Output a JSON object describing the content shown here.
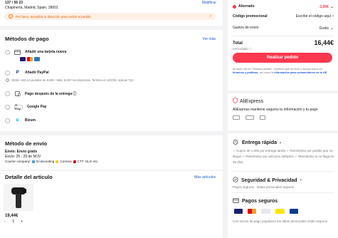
{
  "address": {
    "line1": "137 / 56 23",
    "line2": "Chapinería, Madrid, Spain, 28001",
    "modify_label": "Modificar",
    "warning": "Por favor, actualiza tu dirección para recibir el pedido",
    "warning_icon": "info-icon"
  },
  "payment": {
    "title": "Métodos de pago",
    "see_more": "Ver más",
    "methods": [
      {
        "label": "Añadir una tarjeta nueva",
        "icon": "card-icon"
      },
      {
        "label": "Añadir PayPal",
        "icon": "paypal-icon"
      },
      {
        "label": "Pago después de la entrega ⓘ",
        "icon": "cash-on-delivery-icon"
      },
      {
        "label": "Google Pay",
        "icon": "google-pay-icon"
      },
      {
        "label": "Bizum",
        "icon": "bizum-icon"
      }
    ],
    "paypal_note": "Obtén -€20 en pedidos de €199+. Más, 8,057 recompensas. Termina el 12/3/25. Aplican TyC."
  },
  "shipping": {
    "title": "Método de envío",
    "method": "Envío: Envío gratis",
    "eta": "Envío: 25 - 29 de NOV",
    "couriers_prefix": "Courier company:",
    "couriers": [
      "Ecoscooting",
      "Correos",
      "CTT",
      "GLS",
      "etc."
    ]
  },
  "item": {
    "title": "Detalle del artículo",
    "more": "Más artículos",
    "price": "19,44€",
    "qty": "1",
    "minus": "−",
    "plus": "+"
  },
  "summary": {
    "saved_label": "Ahorrado",
    "saved_value": "-3,00€",
    "promo_label": "Código promocional",
    "promo_value": "Escribe el código aquí",
    "shipping_label": "Gastos de envío",
    "shipping_value": "Gratis",
    "total_label": "Total",
    "total_value": "16,44€",
    "vat_note": "IVA incluido ⓘ",
    "place_order": "Realizar pedido",
    "legal_1": "Al hacer clic en \"Realizar pedido\", confirmo que he leído y acepto todos los",
    "legal_terms": "términos y políticas",
    "legal_2": ", así como la",
    "legal_info": "información para consumidores en la UE."
  },
  "trust": {
    "brand": "AliExpress",
    "text": "AliExpress mantiene seguros tu información y tu pago"
  },
  "services": {
    "fast": {
      "title": "Entrega rápida",
      "lines": [
        "✓ Cupón de 1,00€ por entrega tardía",
        "✓ Reembolso por pedido que no llegue",
        "✓ Reembolso por artículos dañados",
        "✓ Reembolso si no llega en 35 días"
      ]
    },
    "security": {
      "title": "Seguridad & Privacidad",
      "text": "Pagos seguros · Datos personales seguros"
    },
    "payments": {
      "title": "Pagos seguros",
      "text": "Con socios de pago populares tus datos personales están seguros"
    }
  },
  "colors": {
    "accent": "#fd384f",
    "link": "#1a56d6"
  }
}
